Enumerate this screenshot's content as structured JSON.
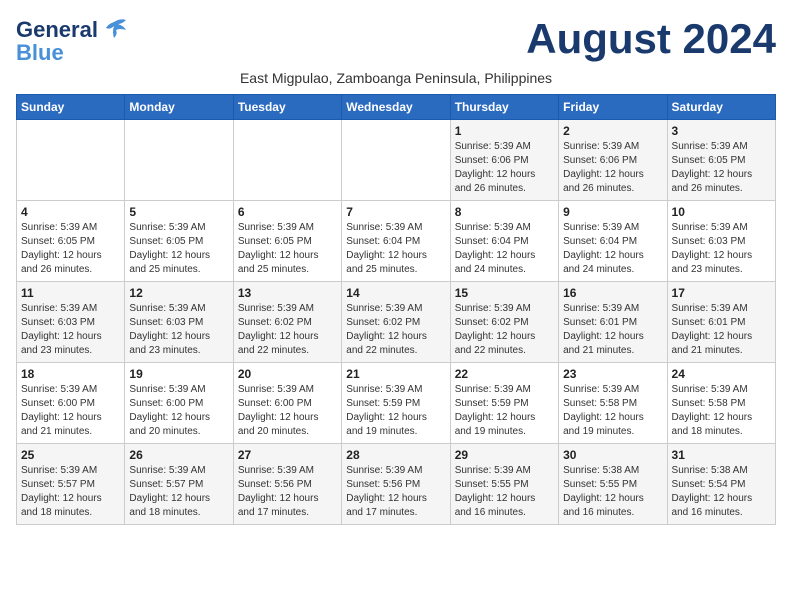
{
  "header": {
    "logo_line1": "General",
    "logo_line2": "Blue",
    "month_title": "August 2024",
    "subtitle": "East Migpulao, Zamboanga Peninsula, Philippines"
  },
  "days_of_week": [
    "Sunday",
    "Monday",
    "Tuesday",
    "Wednesday",
    "Thursday",
    "Friday",
    "Saturday"
  ],
  "weeks": [
    [
      {
        "day": "",
        "info": ""
      },
      {
        "day": "",
        "info": ""
      },
      {
        "day": "",
        "info": ""
      },
      {
        "day": "",
        "info": ""
      },
      {
        "day": "1",
        "info": "Sunrise: 5:39 AM\nSunset: 6:06 PM\nDaylight: 12 hours\nand 26 minutes."
      },
      {
        "day": "2",
        "info": "Sunrise: 5:39 AM\nSunset: 6:06 PM\nDaylight: 12 hours\nand 26 minutes."
      },
      {
        "day": "3",
        "info": "Sunrise: 5:39 AM\nSunset: 6:05 PM\nDaylight: 12 hours\nand 26 minutes."
      }
    ],
    [
      {
        "day": "4",
        "info": "Sunrise: 5:39 AM\nSunset: 6:05 PM\nDaylight: 12 hours\nand 26 minutes."
      },
      {
        "day": "5",
        "info": "Sunrise: 5:39 AM\nSunset: 6:05 PM\nDaylight: 12 hours\nand 25 minutes."
      },
      {
        "day": "6",
        "info": "Sunrise: 5:39 AM\nSunset: 6:05 PM\nDaylight: 12 hours\nand 25 minutes."
      },
      {
        "day": "7",
        "info": "Sunrise: 5:39 AM\nSunset: 6:04 PM\nDaylight: 12 hours\nand 25 minutes."
      },
      {
        "day": "8",
        "info": "Sunrise: 5:39 AM\nSunset: 6:04 PM\nDaylight: 12 hours\nand 24 minutes."
      },
      {
        "day": "9",
        "info": "Sunrise: 5:39 AM\nSunset: 6:04 PM\nDaylight: 12 hours\nand 24 minutes."
      },
      {
        "day": "10",
        "info": "Sunrise: 5:39 AM\nSunset: 6:03 PM\nDaylight: 12 hours\nand 23 minutes."
      }
    ],
    [
      {
        "day": "11",
        "info": "Sunrise: 5:39 AM\nSunset: 6:03 PM\nDaylight: 12 hours\nand 23 minutes."
      },
      {
        "day": "12",
        "info": "Sunrise: 5:39 AM\nSunset: 6:03 PM\nDaylight: 12 hours\nand 23 minutes."
      },
      {
        "day": "13",
        "info": "Sunrise: 5:39 AM\nSunset: 6:02 PM\nDaylight: 12 hours\nand 22 minutes."
      },
      {
        "day": "14",
        "info": "Sunrise: 5:39 AM\nSunset: 6:02 PM\nDaylight: 12 hours\nand 22 minutes."
      },
      {
        "day": "15",
        "info": "Sunrise: 5:39 AM\nSunset: 6:02 PM\nDaylight: 12 hours\nand 22 minutes."
      },
      {
        "day": "16",
        "info": "Sunrise: 5:39 AM\nSunset: 6:01 PM\nDaylight: 12 hours\nand 21 minutes."
      },
      {
        "day": "17",
        "info": "Sunrise: 5:39 AM\nSunset: 6:01 PM\nDaylight: 12 hours\nand 21 minutes."
      }
    ],
    [
      {
        "day": "18",
        "info": "Sunrise: 5:39 AM\nSunset: 6:00 PM\nDaylight: 12 hours\nand 21 minutes."
      },
      {
        "day": "19",
        "info": "Sunrise: 5:39 AM\nSunset: 6:00 PM\nDaylight: 12 hours\nand 20 minutes."
      },
      {
        "day": "20",
        "info": "Sunrise: 5:39 AM\nSunset: 6:00 PM\nDaylight: 12 hours\nand 20 minutes."
      },
      {
        "day": "21",
        "info": "Sunrise: 5:39 AM\nSunset: 5:59 PM\nDaylight: 12 hours\nand 19 minutes."
      },
      {
        "day": "22",
        "info": "Sunrise: 5:39 AM\nSunset: 5:59 PM\nDaylight: 12 hours\nand 19 minutes."
      },
      {
        "day": "23",
        "info": "Sunrise: 5:39 AM\nSunset: 5:58 PM\nDaylight: 12 hours\nand 19 minutes."
      },
      {
        "day": "24",
        "info": "Sunrise: 5:39 AM\nSunset: 5:58 PM\nDaylight: 12 hours\nand 18 minutes."
      }
    ],
    [
      {
        "day": "25",
        "info": "Sunrise: 5:39 AM\nSunset: 5:57 PM\nDaylight: 12 hours\nand 18 minutes."
      },
      {
        "day": "26",
        "info": "Sunrise: 5:39 AM\nSunset: 5:57 PM\nDaylight: 12 hours\nand 18 minutes."
      },
      {
        "day": "27",
        "info": "Sunrise: 5:39 AM\nSunset: 5:56 PM\nDaylight: 12 hours\nand 17 minutes."
      },
      {
        "day": "28",
        "info": "Sunrise: 5:39 AM\nSunset: 5:56 PM\nDaylight: 12 hours\nand 17 minutes."
      },
      {
        "day": "29",
        "info": "Sunrise: 5:39 AM\nSunset: 5:55 PM\nDaylight: 12 hours\nand 16 minutes."
      },
      {
        "day": "30",
        "info": "Sunrise: 5:38 AM\nSunset: 5:55 PM\nDaylight: 12 hours\nand 16 minutes."
      },
      {
        "day": "31",
        "info": "Sunrise: 5:38 AM\nSunset: 5:54 PM\nDaylight: 12 hours\nand 16 minutes."
      }
    ]
  ]
}
